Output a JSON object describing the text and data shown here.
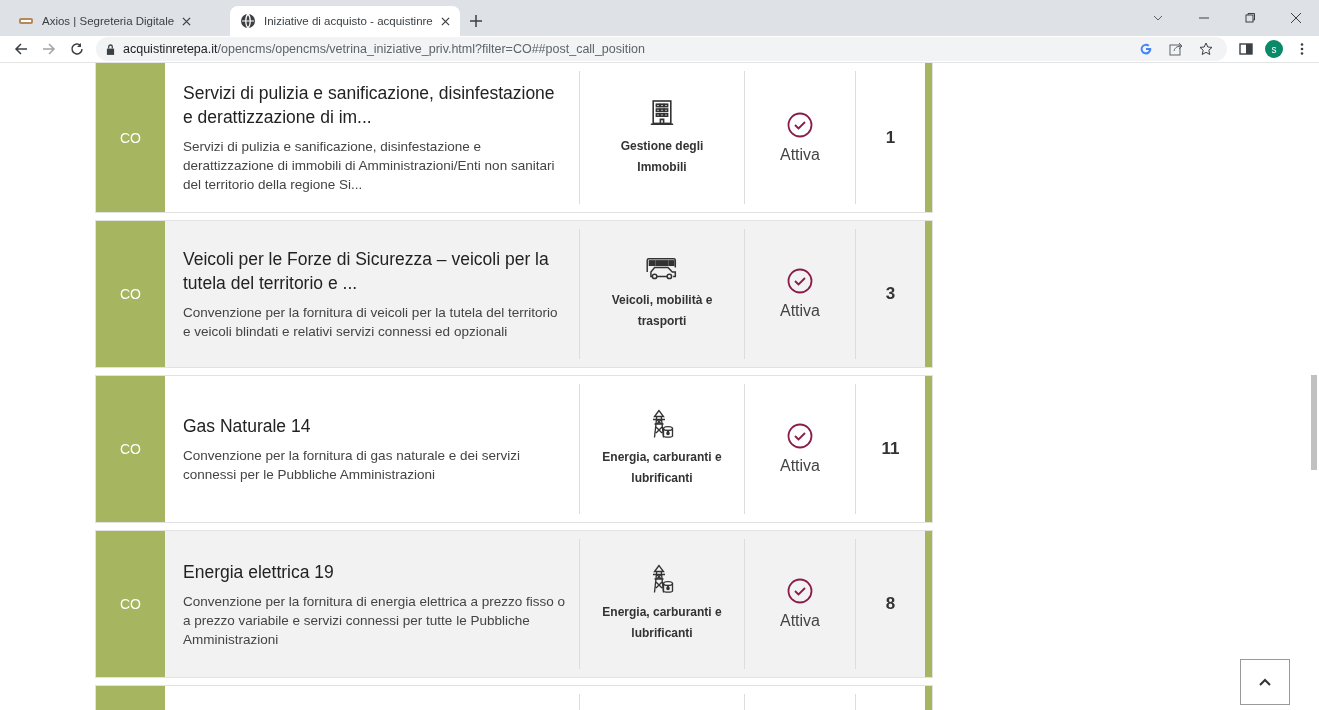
{
  "browser": {
    "tabs": [
      {
        "title": "Axios | Segreteria Digitale",
        "selected": false
      },
      {
        "title": "Iniziative di acquisto - acquistinre",
        "selected": true
      }
    ],
    "url_host": "acquistinretepa.it",
    "url_path": "/opencms/opencms/vetrina_iniziative_priv.html?filter=CO##post_call_position",
    "profile_initial": "s"
  },
  "initiatives": [
    {
      "type": "CO",
      "title": "Servizi di pulizia e sanificazione, disinfestazione e derattizzazione di im...",
      "description": "Servizi di pulizia e sanificazione, disinfestazione e derattizzazione di immobili di Amministrazioni/Enti non sanitari del territorio della regione Si...",
      "category": "Gestione degli Immobili",
      "kind": "building",
      "status": "Attiva",
      "active": true,
      "count": "1"
    },
    {
      "type": "CO",
      "title": "Veicoli per le Forze di Sicurezza – veicoli per la tutela del territorio e ...",
      "description": "Convenzione per la fornitura di veicoli per la tutela del territorio e veicoli blindati e relativi servizi connessi ed opzionali",
      "category": "Veicoli, mobilità e trasporti",
      "kind": "vehicles",
      "status": "Attiva",
      "active": true,
      "count": "3"
    },
    {
      "type": "CO",
      "title": "Gas Naturale 14",
      "description": "Convenzione per la fornitura di gas naturale e dei servizi connessi per le Pubbliche Amministrazioni",
      "category": "Energia, carburanti e lubrificanti",
      "kind": "energy",
      "status": "Attiva",
      "active": true,
      "count": "11"
    },
    {
      "type": "CO",
      "title": "Energia elettrica 19",
      "description": "Convenzione per la fornitura di energia elettrica a prezzo fisso o a prezzo variabile e servizi connessi per tutte le Pubbliche Amministrazioni",
      "category": "Energia, carburanti e lubrificanti",
      "kind": "energy",
      "status": "Attiva",
      "active": true,
      "count": "8"
    }
  ]
}
